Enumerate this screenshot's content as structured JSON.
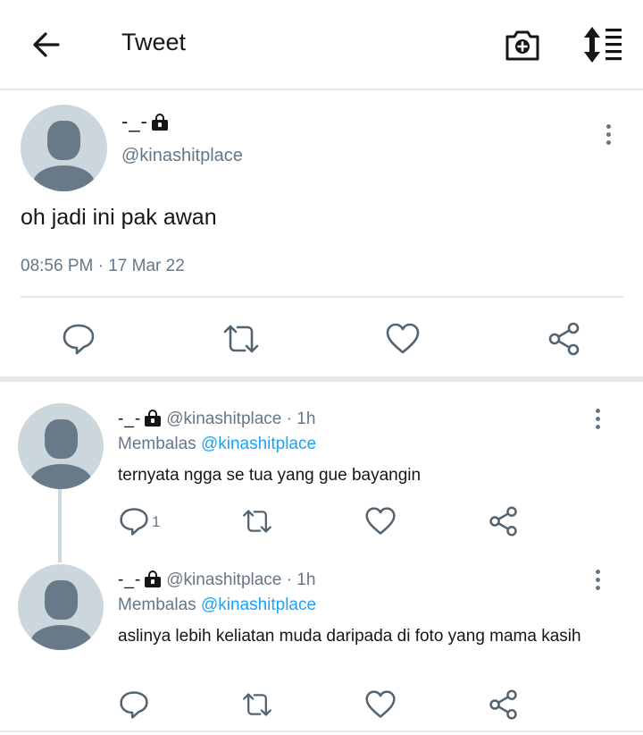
{
  "app": {
    "title": "Tweet"
  },
  "main_tweet": {
    "display_name": "-_-",
    "handle": "@kinashitplace",
    "text": "oh jadi ini pak awan",
    "timestamp": "08:56 PM · 17 Mar 22"
  },
  "replies": [
    {
      "display_name": "-_-",
      "handle": "@kinashitplace",
      "time": "· 1h",
      "replying_prefix": "Membalas",
      "replying_to": "@kinashitplace",
      "text": "ternyata ngga se tua yang gue bayangin",
      "reply_count": "1"
    },
    {
      "display_name": "-_-",
      "handle": "@kinashitplace",
      "time": "· 1h",
      "replying_prefix": "Membalas",
      "replying_to": "@kinashitplace",
      "text": "aslinya lebih keliatan muda daripada di foto yang mama kasih",
      "reply_count": ""
    }
  ],
  "icons": {
    "back": "arrow-left-icon",
    "camera": "camera-add-icon",
    "sort": "sort-icon",
    "more": "more-vertical-icon",
    "lock": "lock-icon",
    "reply": "reply-icon",
    "retweet": "retweet-icon",
    "like": "heart-icon",
    "share": "share-icon"
  },
  "colors": {
    "accent": "#1da1f2",
    "text": "#14171a",
    "muted": "#657786",
    "avatar_bg": "#ccd6dd",
    "avatar_fg": "#687a8a",
    "divider": "#e6e9ec"
  }
}
